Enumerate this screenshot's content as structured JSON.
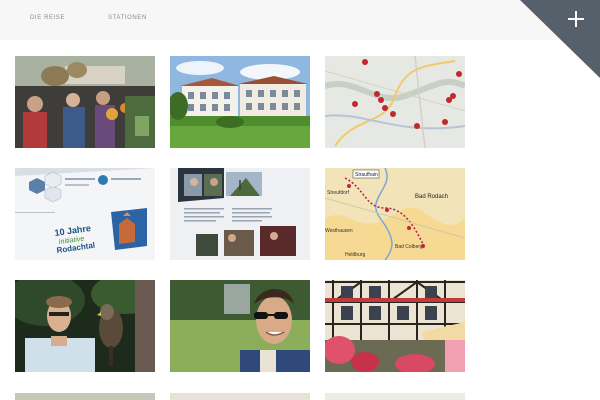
{
  "nav": {
    "items": [
      {
        "label": "DIE REISE"
      },
      {
        "label": "STATIONEN"
      }
    ]
  },
  "corner": {
    "icon": "plus-icon",
    "color": "#55606b"
  },
  "gallery": {
    "rows": [
      {
        "tiles": [
          {
            "subject": "market-crowd"
          },
          {
            "subject": "hotel-building"
          },
          {
            "subject": "route-map-pins"
          }
        ]
      },
      {
        "tiles": [
          {
            "subject": "brochure-cover"
          },
          {
            "subject": "brochure-spread"
          },
          {
            "subject": "region-map-route"
          }
        ]
      },
      {
        "tiles": [
          {
            "subject": "man-with-falcon"
          },
          {
            "subject": "man-sunglasses"
          },
          {
            "subject": "timber-frame-house"
          }
        ]
      }
    ],
    "brochure_text": {
      "line1": "10 Jahre",
      "line2": "Initiative",
      "line3": "Rodachtal"
    },
    "map_labels": {
      "town1": "Straufhain",
      "town2": "Streufdorf",
      "town3": "Bad Rodach",
      "town4": "Westhausen",
      "town5": "Heldburg",
      "town6": "Bad Colberg"
    }
  }
}
